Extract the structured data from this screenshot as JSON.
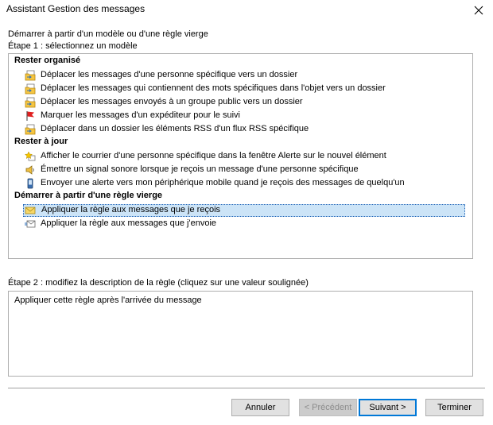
{
  "window": {
    "title": "Assistant Gestion des messages"
  },
  "intro": "Démarrer à partir d'un modèle ou d'une règle vierge",
  "step1": {
    "label": "Étape 1 : sélectionnez un modèle"
  },
  "sections": [
    {
      "title": "Rester organisé",
      "items": [
        {
          "label": "Déplacer les messages d'une personne spécifique vers un dossier",
          "icon": "folder-move-icon"
        },
        {
          "label": "Déplacer les messages qui contiennent des mots spécifiques dans l'objet vers un dossier",
          "icon": "folder-move-icon"
        },
        {
          "label": "Déplacer les messages envoyés à un groupe public vers un dossier",
          "icon": "folder-move-icon"
        },
        {
          "label": "Marquer les messages d'un expéditeur pour le suivi",
          "icon": "red-flag-icon"
        },
        {
          "label": "Déplacer dans un dossier les éléments RSS d'un flux RSS spécifique",
          "icon": "folder-move-icon"
        }
      ]
    },
    {
      "title": "Rester à jour",
      "items": [
        {
          "label": "Afficher le courrier d'une personne spécifique dans la fenêtre Alerte sur le nouvel élément",
          "icon": "alert-star-icon"
        },
        {
          "label": "Émettre un signal sonore lorsque je reçois un message d'une personne spécifique",
          "icon": "speaker-icon"
        },
        {
          "label": "Envoyer une alerte vers mon périphérique mobile quand je reçois des messages de quelqu'un",
          "icon": "mobile-phone-icon"
        }
      ]
    },
    {
      "title": "Démarrer à partir d'une règle vierge",
      "items": [
        {
          "label": "Appliquer la règle aux messages que je reçois",
          "icon": "envelope-icon",
          "selected": true
        },
        {
          "label": "Appliquer la règle aux messages que j'envoie",
          "icon": "send-mail-icon"
        }
      ]
    }
  ],
  "step2": {
    "label": "Étape 2 : modifiez la description de la règle (cliquez sur une valeur soulignée)",
    "description": "Appliquer cette règle après l'arrivée du message"
  },
  "buttons": {
    "cancel": "Annuler",
    "previous": "< Précédent",
    "next": "Suivant >",
    "finish": "Terminer"
  },
  "colors": {
    "selection_bg": "#cce4f7",
    "selection_border": "#1a5fb4",
    "default_button_border": "#0078d7"
  }
}
